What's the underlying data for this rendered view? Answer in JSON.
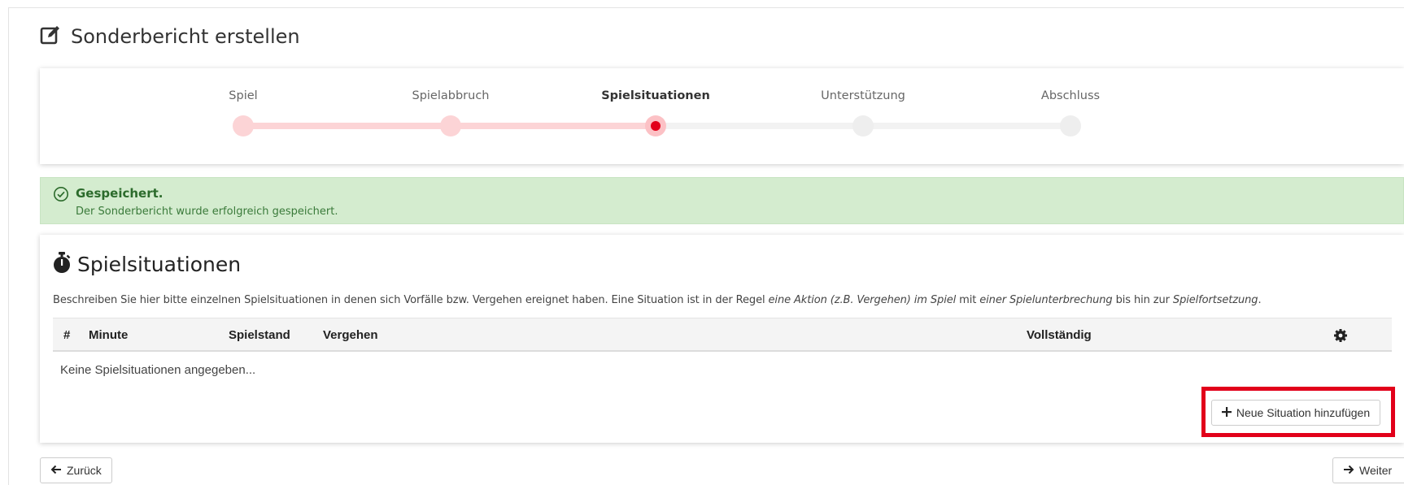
{
  "page": {
    "title": "Sonderbericht erstellen",
    "title_icon": "edit-icon"
  },
  "stepper": {
    "steps": [
      {
        "label": "Spiel",
        "state": "done"
      },
      {
        "label": "Spielabbruch",
        "state": "done"
      },
      {
        "label": "Spielsituationen",
        "state": "active"
      },
      {
        "label": "Unterstützung",
        "state": "pending"
      },
      {
        "label": "Abschluss",
        "state": "pending"
      }
    ]
  },
  "alert": {
    "title": "Gespeichert.",
    "text": "Der Sonderbericht wurde erfolgreich gespeichert.",
    "icon": "check-circle-icon"
  },
  "section": {
    "title": "Spielsituationen",
    "icon": "stopwatch-icon",
    "description_parts": {
      "p1": "Beschreiben Sie hier bitte einzelnen Spielsituationen in denen sich Vorfälle bzw. Vergehen ereignet haben. Eine Situation ist in der Regel ",
      "e1": "eine Aktion (z.B. Vergehen) im Spiel",
      "p2": " mit ",
      "e2": "einer Spielunterbrechung",
      "p3": " bis hin zur ",
      "e3": "Spielfortsetzung",
      "p4": "."
    }
  },
  "table": {
    "columns": [
      "#",
      "Minute",
      "Spielstand",
      "Vergehen",
      "Vollständig"
    ],
    "settings_icon": "gear-icon",
    "rows": [],
    "empty_text": "Keine Spielsituationen angegeben..."
  },
  "actions": {
    "add_label": "Neue Situation hinzufügen",
    "back_label": "Zurück",
    "next_label": "Weiter"
  },
  "colors": {
    "accent": "#e2001a",
    "step_done": "#fcd4d6",
    "alert_bg": "#d4eccf",
    "alert_text": "#2c6b2c"
  }
}
